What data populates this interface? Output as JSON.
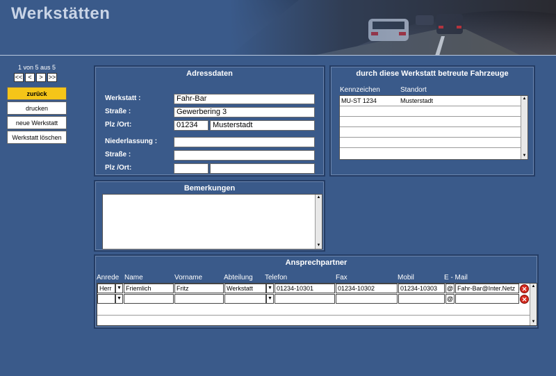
{
  "header": {
    "title": "Werkstätten"
  },
  "nav": {
    "record_count": "1 von 5 aus 5",
    "pager": [
      "<<",
      "<",
      ">",
      ">>"
    ],
    "buttons": [
      "zurück",
      "drucken",
      "neue Werkstatt",
      "Werkstatt löschen"
    ]
  },
  "adressdaten": {
    "title": "Adressdaten",
    "labels": {
      "werkstatt": "Werkstatt :",
      "strasse": "Straße :",
      "plz_ort": "Plz /Ort:",
      "niederlassung": "Niederlassung :",
      "strasse2": "Straße :",
      "plz_ort2": "Plz /Ort:"
    },
    "values": {
      "werkstatt": "Fahr-Bar",
      "strasse": "Gewerbering 3",
      "plz": "01234",
      "ort": "Musterstadt",
      "niederlassung": "",
      "strasse2": "",
      "plz2": "",
      "ort2": ""
    }
  },
  "fahrzeuge": {
    "title": "durch diese Werkstatt betreute Fahrzeuge",
    "columns": [
      "Kennzeichen",
      "Standort"
    ],
    "rows": [
      {
        "kennzeichen": "MU-ST 1234",
        "standort": "Musterstadt"
      }
    ]
  },
  "bemerkungen": {
    "title": "Bemerkungen",
    "text": ""
  },
  "ansprechpartner": {
    "title": "Ansprechpartner",
    "columns": [
      "Anrede",
      "Name",
      "Vorname",
      "Abteilung",
      "Telefon",
      "Fax",
      "Mobil",
      "E - Mail"
    ],
    "rows": [
      {
        "anrede": "Herr",
        "name": "Friemlich",
        "vorname": "Fritz",
        "abteilung": "Werkstatt",
        "telefon": "01234-10301",
        "fax": "01234-10302",
        "mobil": "01234-10303",
        "email": "Fahr-Bar@Inter.Netz"
      },
      {
        "anrede": "",
        "name": "",
        "vorname": "",
        "abteilung": "",
        "telefon": "",
        "fax": "",
        "mobil": "",
        "email": ""
      }
    ],
    "email_icon": "@",
    "delete_icon": "✕"
  },
  "icons": {
    "scroll_up": "▲",
    "scroll_down": "▼",
    "dropdown": "▼"
  },
  "colors": {
    "background": "#3a5a8a",
    "accent_button": "#f5c518",
    "delete": "#d62a1e"
  }
}
